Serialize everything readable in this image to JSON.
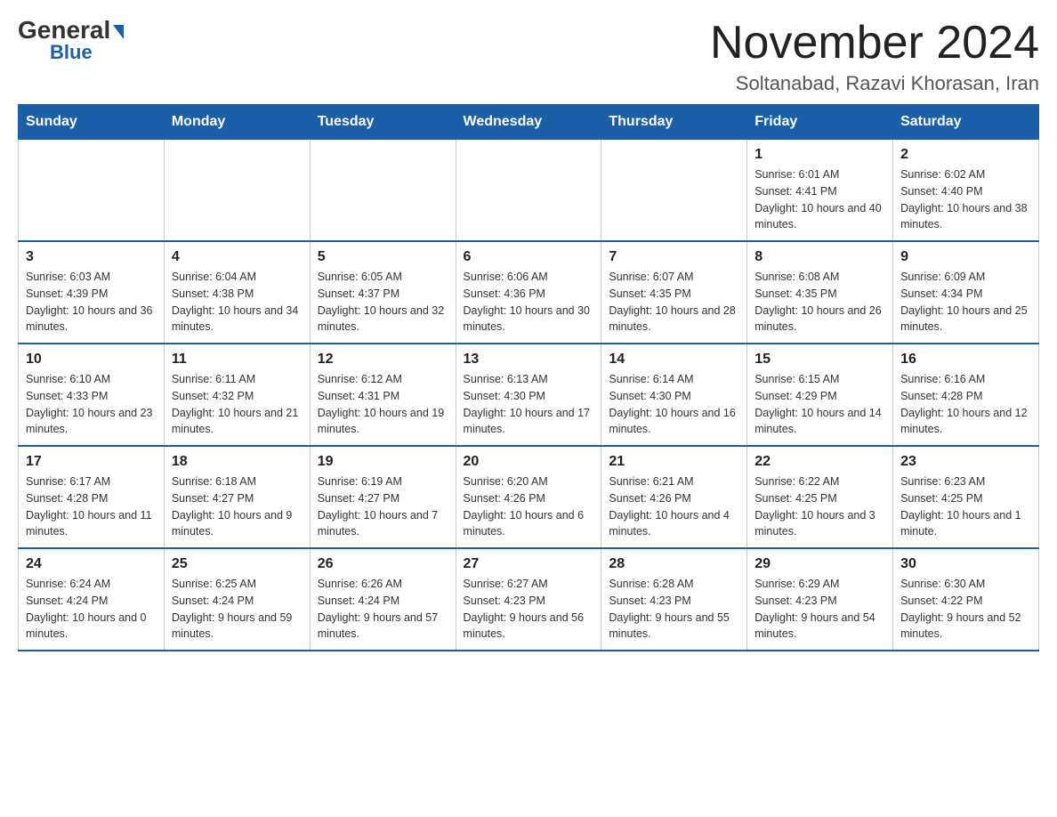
{
  "header": {
    "logo_general": "General",
    "logo_blue": "Blue",
    "month_title": "November 2024",
    "location": "Soltanabad, Razavi Khorasan, Iran"
  },
  "weekdays": [
    "Sunday",
    "Monday",
    "Tuesday",
    "Wednesday",
    "Thursday",
    "Friday",
    "Saturday"
  ],
  "weeks": [
    [
      {
        "day": "",
        "info": ""
      },
      {
        "day": "",
        "info": ""
      },
      {
        "day": "",
        "info": ""
      },
      {
        "day": "",
        "info": ""
      },
      {
        "day": "",
        "info": ""
      },
      {
        "day": "1",
        "info": "Sunrise: 6:01 AM\nSunset: 4:41 PM\nDaylight: 10 hours and 40 minutes."
      },
      {
        "day": "2",
        "info": "Sunrise: 6:02 AM\nSunset: 4:40 PM\nDaylight: 10 hours and 38 minutes."
      }
    ],
    [
      {
        "day": "3",
        "info": "Sunrise: 6:03 AM\nSunset: 4:39 PM\nDaylight: 10 hours and 36 minutes."
      },
      {
        "day": "4",
        "info": "Sunrise: 6:04 AM\nSunset: 4:38 PM\nDaylight: 10 hours and 34 minutes."
      },
      {
        "day": "5",
        "info": "Sunrise: 6:05 AM\nSunset: 4:37 PM\nDaylight: 10 hours and 32 minutes."
      },
      {
        "day": "6",
        "info": "Sunrise: 6:06 AM\nSunset: 4:36 PM\nDaylight: 10 hours and 30 minutes."
      },
      {
        "day": "7",
        "info": "Sunrise: 6:07 AM\nSunset: 4:35 PM\nDaylight: 10 hours and 28 minutes."
      },
      {
        "day": "8",
        "info": "Sunrise: 6:08 AM\nSunset: 4:35 PM\nDaylight: 10 hours and 26 minutes."
      },
      {
        "day": "9",
        "info": "Sunrise: 6:09 AM\nSunset: 4:34 PM\nDaylight: 10 hours and 25 minutes."
      }
    ],
    [
      {
        "day": "10",
        "info": "Sunrise: 6:10 AM\nSunset: 4:33 PM\nDaylight: 10 hours and 23 minutes."
      },
      {
        "day": "11",
        "info": "Sunrise: 6:11 AM\nSunset: 4:32 PM\nDaylight: 10 hours and 21 minutes."
      },
      {
        "day": "12",
        "info": "Sunrise: 6:12 AM\nSunset: 4:31 PM\nDaylight: 10 hours and 19 minutes."
      },
      {
        "day": "13",
        "info": "Sunrise: 6:13 AM\nSunset: 4:30 PM\nDaylight: 10 hours and 17 minutes."
      },
      {
        "day": "14",
        "info": "Sunrise: 6:14 AM\nSunset: 4:30 PM\nDaylight: 10 hours and 16 minutes."
      },
      {
        "day": "15",
        "info": "Sunrise: 6:15 AM\nSunset: 4:29 PM\nDaylight: 10 hours and 14 minutes."
      },
      {
        "day": "16",
        "info": "Sunrise: 6:16 AM\nSunset: 4:28 PM\nDaylight: 10 hours and 12 minutes."
      }
    ],
    [
      {
        "day": "17",
        "info": "Sunrise: 6:17 AM\nSunset: 4:28 PM\nDaylight: 10 hours and 11 minutes."
      },
      {
        "day": "18",
        "info": "Sunrise: 6:18 AM\nSunset: 4:27 PM\nDaylight: 10 hours and 9 minutes."
      },
      {
        "day": "19",
        "info": "Sunrise: 6:19 AM\nSunset: 4:27 PM\nDaylight: 10 hours and 7 minutes."
      },
      {
        "day": "20",
        "info": "Sunrise: 6:20 AM\nSunset: 4:26 PM\nDaylight: 10 hours and 6 minutes."
      },
      {
        "day": "21",
        "info": "Sunrise: 6:21 AM\nSunset: 4:26 PM\nDaylight: 10 hours and 4 minutes."
      },
      {
        "day": "22",
        "info": "Sunrise: 6:22 AM\nSunset: 4:25 PM\nDaylight: 10 hours and 3 minutes."
      },
      {
        "day": "23",
        "info": "Sunrise: 6:23 AM\nSunset: 4:25 PM\nDaylight: 10 hours and 1 minute."
      }
    ],
    [
      {
        "day": "24",
        "info": "Sunrise: 6:24 AM\nSunset: 4:24 PM\nDaylight: 10 hours and 0 minutes."
      },
      {
        "day": "25",
        "info": "Sunrise: 6:25 AM\nSunset: 4:24 PM\nDaylight: 9 hours and 59 minutes."
      },
      {
        "day": "26",
        "info": "Sunrise: 6:26 AM\nSunset: 4:24 PM\nDaylight: 9 hours and 57 minutes."
      },
      {
        "day": "27",
        "info": "Sunrise: 6:27 AM\nSunset: 4:23 PM\nDaylight: 9 hours and 56 minutes."
      },
      {
        "day": "28",
        "info": "Sunrise: 6:28 AM\nSunset: 4:23 PM\nDaylight: 9 hours and 55 minutes."
      },
      {
        "day": "29",
        "info": "Sunrise: 6:29 AM\nSunset: 4:23 PM\nDaylight: 9 hours and 54 minutes."
      },
      {
        "day": "30",
        "info": "Sunrise: 6:30 AM\nSunset: 4:22 PM\nDaylight: 9 hours and 52 minutes."
      }
    ]
  ]
}
